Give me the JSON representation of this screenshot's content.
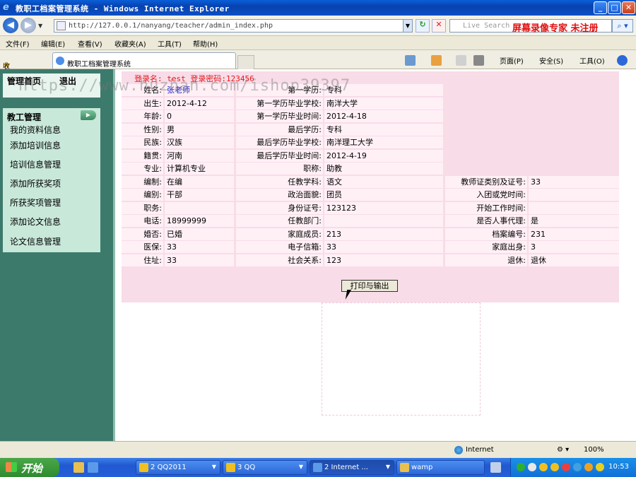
{
  "window": {
    "title": "教职工档案管理系统 - Windows Internet Explorer",
    "min": "_",
    "max": "□",
    "close": "✕"
  },
  "address": {
    "url": "http://127.0.0.1/nanyang/teacher/admin_index.php",
    "search_placeholder": "Live Search",
    "watermark": "屏幕录像专家 未注册"
  },
  "menu": [
    "文件(F)",
    "编辑(E)",
    "查看(V)",
    "收藏夹(A)",
    "工具(T)",
    "帮助(H)"
  ],
  "tabs": {
    "favorites": "收藏夹",
    "active_tab": "教职工档案管理系统",
    "page_menu": "页面(P)",
    "safety_menu": "安全(S)",
    "tools_menu": "工具(O)"
  },
  "sidebar": {
    "home": "管理首页",
    "logout": "退出",
    "section": "教工管理",
    "items": [
      "我的资料信息",
      "添加培训信息",
      "培训信息管理",
      "添加所获奖项",
      "所获奖项管理",
      "添加论文信息",
      "论文信息管理"
    ]
  },
  "main": {
    "login_info": "登录名: test 登录密码:123456",
    "url_watermark": "https://www.huzhan.com/ishop39397",
    "print_button": "打印与输出",
    "rows": [
      [
        "姓名:",
        "张老师",
        "第一学历:",
        "专科",
        "",
        ""
      ],
      [
        "出生:",
        "2012-4-12",
        "第一学历毕业学校:",
        "南洋大学",
        "",
        ""
      ],
      [
        "年龄:",
        "0",
        "第一学历毕业时间:",
        "2012-4-18",
        "",
        ""
      ],
      [
        "性别:",
        "男",
        "最后学历:",
        "专科",
        "",
        ""
      ],
      [
        "民族:",
        "汉族",
        "最后学历毕业学校:",
        "南洋理工大学",
        "",
        ""
      ],
      [
        "籍贯:",
        "河南",
        "最后学历毕业时间:",
        "2012-4-19",
        "",
        ""
      ],
      [
        "专业:",
        "计算机专业",
        "职称:",
        "助教",
        "",
        ""
      ],
      [
        "编制:",
        "在编",
        "任教学科:",
        "语文",
        "教师证类别及证号:",
        "33"
      ],
      [
        "编别:",
        "干部",
        "政治面貌:",
        "团员",
        "入团或党时间:",
        ""
      ],
      [
        "职务:",
        "",
        "身份证号:",
        "123123",
        "开始工作时间:",
        ""
      ],
      [
        "电话:",
        "18999999",
        "任教部门:",
        "",
        "是否人事代理:",
        "是"
      ],
      [
        "婚否:",
        "已婚",
        "家庭成员:",
        "213",
        "档案编号:",
        "231"
      ],
      [
        "医保:",
        "33",
        "电子信箱:",
        "33",
        "家庭出身:",
        "3"
      ],
      [
        "住址:",
        "33",
        "社会关系:",
        "123",
        "退休:",
        "退休"
      ]
    ]
  },
  "status": {
    "zone": "Internet",
    "zoom": "100%"
  },
  "taskbar": {
    "start": "开始",
    "tasks": [
      "2 QQ2011",
      "3 QQ",
      "2 Internet ...",
      "wamp"
    ],
    "clock": "10:53"
  }
}
